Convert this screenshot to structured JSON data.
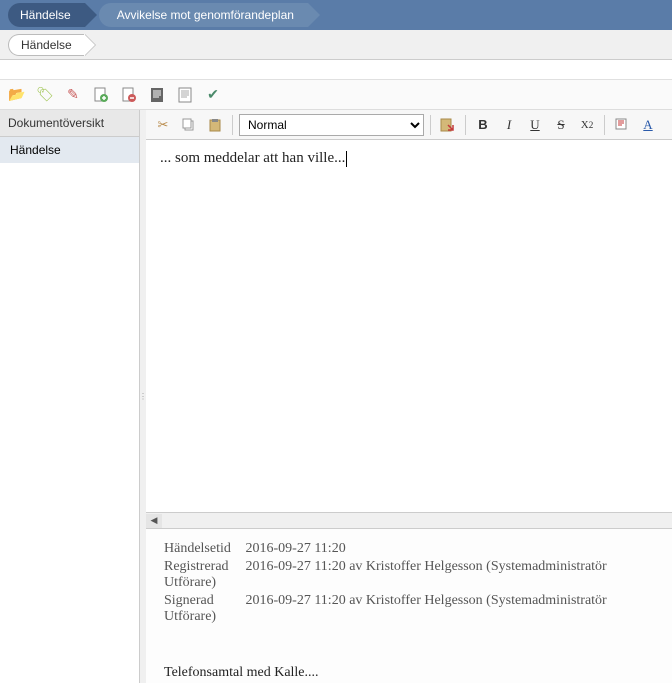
{
  "breadcrumb": {
    "primary": "Händelse",
    "secondary": "Avvikelse mot genomförandeplan"
  },
  "subBreadcrumb": {
    "label": "Händelse"
  },
  "sidebar": {
    "header": "Dokumentöversikt",
    "items": [
      {
        "label": "Händelse",
        "selected": true
      }
    ]
  },
  "editorToolbar": {
    "styleSelect": "Normal"
  },
  "editor": {
    "content": "... som meddelar att han ville..."
  },
  "metadata": {
    "rows": [
      {
        "label": "Händelsetid",
        "value": "2016-09-27 11:20"
      },
      {
        "label": "Registrerad",
        "value": "2016-09-27 11:20 av Kristoffer Helgesson (Systemadministratör Utförare)"
      },
      {
        "label": "Signerad",
        "value": "2016-09-27 11:20 av Kristoffer Helgesson (Systemadministratör Utförare)"
      }
    ],
    "noteText": "Telefonsamtal med Kalle...."
  }
}
